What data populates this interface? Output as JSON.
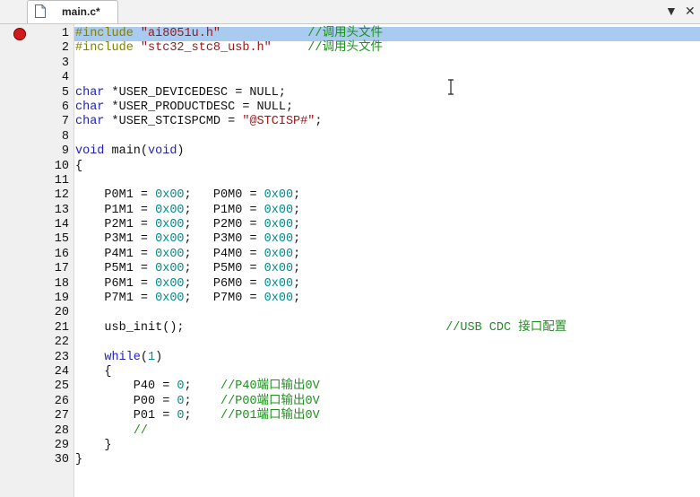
{
  "tab": {
    "label": "main.c*",
    "icon": "file-icon"
  },
  "window_controls": {
    "dropdown": "▼",
    "close": "✕"
  },
  "breakpoint_line": 1,
  "current_line": 1,
  "lines": [
    {
      "n": "1",
      "tokens": [
        [
          "pre",
          "#include "
        ],
        [
          "str",
          "\"ai8051u.h\""
        ],
        [
          "pl",
          "            "
        ],
        [
          "cm",
          "//调用头文件"
        ]
      ]
    },
    {
      "n": "2",
      "tokens": [
        [
          "pre",
          "#include "
        ],
        [
          "str",
          "\"stc32_stc8_usb.h\""
        ],
        [
          "pl",
          "     "
        ],
        [
          "cm",
          "//调用头文件"
        ]
      ]
    },
    {
      "n": "3",
      "tokens": []
    },
    {
      "n": "4",
      "tokens": []
    },
    {
      "n": "5",
      "tokens": [
        [
          "kw",
          "char"
        ],
        [
          "pl",
          " *USER_DEVICEDESC = NULL;"
        ]
      ]
    },
    {
      "n": "6",
      "tokens": [
        [
          "kw",
          "char"
        ],
        [
          "pl",
          " *USER_PRODUCTDESC = NULL;"
        ]
      ]
    },
    {
      "n": "7",
      "tokens": [
        [
          "kw",
          "char"
        ],
        [
          "pl",
          " *USER_STCISPCMD = "
        ],
        [
          "str",
          "\"@STCISP#\""
        ],
        [
          "pl",
          ";"
        ]
      ]
    },
    {
      "n": "8",
      "tokens": []
    },
    {
      "n": "9",
      "tokens": [
        [
          "kw",
          "void"
        ],
        [
          "pl",
          " main("
        ],
        [
          "kw",
          "void"
        ],
        [
          "pl",
          ")"
        ]
      ]
    },
    {
      "n": "10",
      "tokens": [
        [
          "pl",
          "{"
        ]
      ]
    },
    {
      "n": "11",
      "tokens": []
    },
    {
      "n": "12",
      "tokens": [
        [
          "pl",
          "    P0M1 = "
        ],
        [
          "num",
          "0x00"
        ],
        [
          "pl",
          ";   P0M0 = "
        ],
        [
          "num",
          "0x00"
        ],
        [
          "pl",
          ";"
        ]
      ]
    },
    {
      "n": "13",
      "tokens": [
        [
          "pl",
          "    P1M1 = "
        ],
        [
          "num",
          "0x00"
        ],
        [
          "pl",
          ";   P1M0 = "
        ],
        [
          "num",
          "0x00"
        ],
        [
          "pl",
          ";"
        ]
      ]
    },
    {
      "n": "14",
      "tokens": [
        [
          "pl",
          "    P2M1 = "
        ],
        [
          "num",
          "0x00"
        ],
        [
          "pl",
          ";   P2M0 = "
        ],
        [
          "num",
          "0x00"
        ],
        [
          "pl",
          ";"
        ]
      ]
    },
    {
      "n": "15",
      "tokens": [
        [
          "pl",
          "    P3M1 = "
        ],
        [
          "num",
          "0x00"
        ],
        [
          "pl",
          ";   P3M0 = "
        ],
        [
          "num",
          "0x00"
        ],
        [
          "pl",
          ";"
        ]
      ]
    },
    {
      "n": "16",
      "tokens": [
        [
          "pl",
          "    P4M1 = "
        ],
        [
          "num",
          "0x00"
        ],
        [
          "pl",
          ";   P4M0 = "
        ],
        [
          "num",
          "0x00"
        ],
        [
          "pl",
          ";"
        ]
      ]
    },
    {
      "n": "17",
      "tokens": [
        [
          "pl",
          "    P5M1 = "
        ],
        [
          "num",
          "0x00"
        ],
        [
          "pl",
          ";   P5M0 = "
        ],
        [
          "num",
          "0x00"
        ],
        [
          "pl",
          ";"
        ]
      ]
    },
    {
      "n": "18",
      "tokens": [
        [
          "pl",
          "    P6M1 = "
        ],
        [
          "num",
          "0x00"
        ],
        [
          "pl",
          ";   P6M0 = "
        ],
        [
          "num",
          "0x00"
        ],
        [
          "pl",
          ";"
        ]
      ]
    },
    {
      "n": "19",
      "tokens": [
        [
          "pl",
          "    P7M1 = "
        ],
        [
          "num",
          "0x00"
        ],
        [
          "pl",
          ";   P7M0 = "
        ],
        [
          "num",
          "0x00"
        ],
        [
          "pl",
          ";"
        ]
      ]
    },
    {
      "n": "20",
      "tokens": []
    },
    {
      "n": "21",
      "tokens": [
        [
          "pl",
          "    usb_init();"
        ],
        [
          "pl",
          "                                    "
        ],
        [
          "cm",
          "//USB CDC 接口配置"
        ]
      ]
    },
    {
      "n": "22",
      "tokens": []
    },
    {
      "n": "23",
      "tokens": [
        [
          "pl",
          "    "
        ],
        [
          "kw",
          "while"
        ],
        [
          "pl",
          "("
        ],
        [
          "num",
          "1"
        ],
        [
          "pl",
          ")"
        ]
      ]
    },
    {
      "n": "24",
      "tokens": [
        [
          "pl",
          "    {"
        ]
      ]
    },
    {
      "n": "25",
      "tokens": [
        [
          "pl",
          "        P40 = "
        ],
        [
          "num",
          "0"
        ],
        [
          "pl",
          ";    "
        ],
        [
          "cm",
          "//P40端口输出0V"
        ]
      ]
    },
    {
      "n": "26",
      "tokens": [
        [
          "pl",
          "        P00 = "
        ],
        [
          "num",
          "0"
        ],
        [
          "pl",
          ";    "
        ],
        [
          "cm",
          "//P00端口输出0V"
        ]
      ]
    },
    {
      "n": "27",
      "tokens": [
        [
          "pl",
          "        P01 = "
        ],
        [
          "num",
          "0"
        ],
        [
          "pl",
          ";    "
        ],
        [
          "cm",
          "//P01端口输出0V"
        ]
      ]
    },
    {
      "n": "28",
      "tokens": [
        [
          "pl",
          "        "
        ],
        [
          "cm",
          "//"
        ]
      ]
    },
    {
      "n": "29",
      "tokens": [
        [
          "pl",
          "    }"
        ]
      ]
    },
    {
      "n": "30",
      "tokens": [
        [
          "pl",
          "}"
        ]
      ]
    }
  ]
}
